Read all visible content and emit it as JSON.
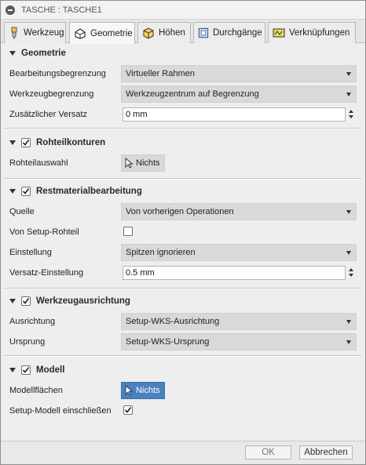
{
  "window": {
    "title": "TASCHE : TASCHE1"
  },
  "tabs": [
    {
      "label": "Werkzeug",
      "icon": "tool-icon"
    },
    {
      "label": "Geometrie",
      "icon": "geometry-icon"
    },
    {
      "label": "Höhen",
      "icon": "heights-icon"
    },
    {
      "label": "Durchgänge",
      "icon": "passes-icon"
    },
    {
      "label": "Verknüpfungen",
      "icon": "linking-icon"
    }
  ],
  "active_tab": "Geometrie",
  "sections": {
    "geometrie": {
      "title": "Geometrie",
      "bearbeitungsbegrenzung": {
        "label": "Bearbeitungsbegrenzung",
        "value": "Virtueller Rahmen"
      },
      "werkzeugbegrenzung": {
        "label": "Werkzeugbegrenzung",
        "value": "Werkzeugzentrum auf Begrenzung"
      },
      "zusaetzlicher_versatz": {
        "label": "Zusätzlicher Versatz",
        "value": "0 mm"
      }
    },
    "rohteilkonturen": {
      "title": "Rohteilkonturen",
      "checked": true,
      "rohteilauswahl": {
        "label": "Rohteilauswahl",
        "button": "Nichts"
      }
    },
    "restmaterial": {
      "title": "Restmaterialbearbeitung",
      "checked": true,
      "quelle": {
        "label": "Quelle",
        "value": "Von vorherigen Operationen"
      },
      "von_setup_rohteil": {
        "label": "Von Setup-Rohteil",
        "checked": false
      },
      "einstellung": {
        "label": "Einstellung",
        "value": "Spitzen ignorieren"
      },
      "versatz_einstellung": {
        "label": "Versatz-Einstellung",
        "value": "0.5 mm"
      }
    },
    "werkzeugausrichtung": {
      "title": "Werkzeugausrichtung",
      "checked": true,
      "ausrichtung": {
        "label": "Ausrichtung",
        "value": "Setup-WKS-Ausrichtung"
      },
      "ursprung": {
        "label": "Ursprung",
        "value": "Setup-WKS-Ursprung"
      }
    },
    "modell": {
      "title": "Modell",
      "checked": true,
      "modellflaechen": {
        "label": "Modellflächen",
        "button": "Nichts"
      },
      "setup_modell": {
        "label": "Setup-Modell einschließen",
        "checked": true
      }
    }
  },
  "footer": {
    "ok": "OK",
    "cancel": "Abbrechen"
  },
  "colors": {
    "selection_active": "#4a82bd",
    "panel": "#eeeeee"
  }
}
